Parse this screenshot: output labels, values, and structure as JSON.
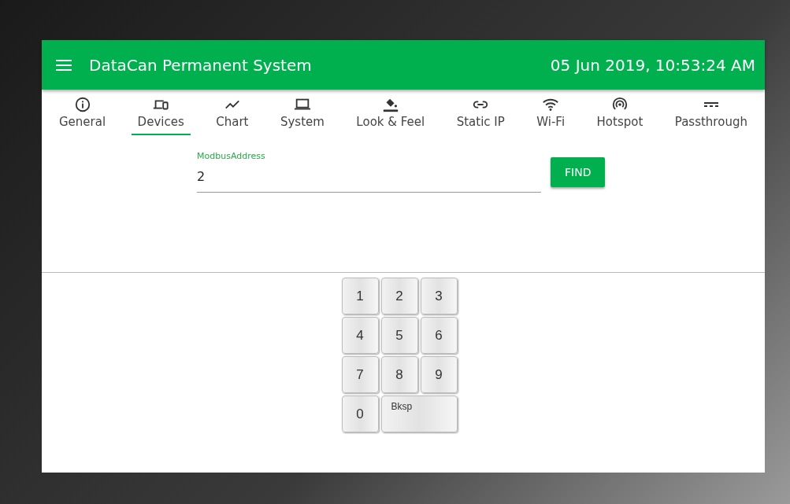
{
  "header": {
    "title": "DataCan Permanent System",
    "datetime": "05 Jun 2019, 10:53:24 AM"
  },
  "tabs": [
    {
      "label": "General",
      "selected": false
    },
    {
      "label": "Devices",
      "selected": true
    },
    {
      "label": "Chart",
      "selected": false
    },
    {
      "label": "System",
      "selected": false
    },
    {
      "label": "Look & Feel",
      "selected": false
    },
    {
      "label": "Static IP",
      "selected": false
    },
    {
      "label": "Wi-Fi",
      "selected": false
    },
    {
      "label": "Hotspot",
      "selected": false
    },
    {
      "label": "Passthrough",
      "selected": false
    }
  ],
  "form": {
    "field_label": "ModbusAddress",
    "value": "2",
    "button": "FIND"
  },
  "keypad": [
    [
      {
        "label": "1",
        "kind": "digit"
      },
      {
        "label": "2",
        "kind": "digit"
      },
      {
        "label": "3",
        "kind": "digit"
      }
    ],
    [
      {
        "label": "4",
        "kind": "digit"
      },
      {
        "label": "5",
        "kind": "digit"
      },
      {
        "label": "6",
        "kind": "digit"
      }
    ],
    [
      {
        "label": "7",
        "kind": "digit"
      },
      {
        "label": "8",
        "kind": "digit"
      },
      {
        "label": "9",
        "kind": "digit"
      }
    ],
    [
      {
        "label": "0",
        "kind": "digit"
      },
      {
        "label": "Bksp",
        "kind": "wide"
      }
    ]
  ]
}
